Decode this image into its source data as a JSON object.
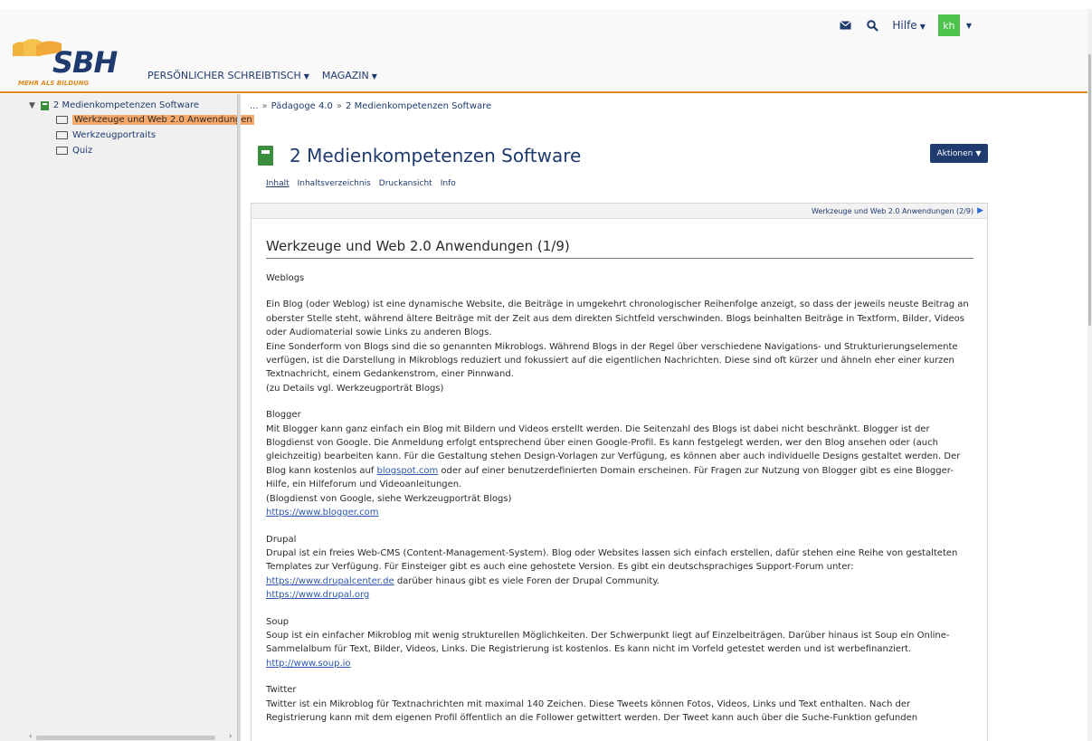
{
  "header": {
    "logo_text": "SBH",
    "logo_tagline": "MEHR ALS BILDUNG",
    "help_label": "Hilfe",
    "user_initials": "kh",
    "nav": [
      {
        "label": "Persönlicher Schreibtisch"
      },
      {
        "label": "Magazin"
      }
    ],
    "icons": {
      "mail": "mail-icon",
      "search": "search-icon"
    },
    "accent_color": "#e08a1e",
    "avatar_color": "#4dc24d"
  },
  "sidebar": {
    "root": "2 Medienkompetenzen Software",
    "items": [
      {
        "label": "Werkzeuge und Web 2.0 Anwendungen",
        "active": true
      },
      {
        "label": "Werkzeugportraits",
        "active": false
      },
      {
        "label": "Quiz",
        "active": false
      }
    ]
  },
  "breadcrumb": {
    "ellipsis": "...",
    "separator": "»",
    "items": [
      "Pädagoge 4.0",
      "2 Medienkompetenzen Software"
    ]
  },
  "page": {
    "title": "2 Medienkompetenzen Software",
    "actions_label": "Aktionen",
    "tabs": [
      {
        "label": "Inhalt",
        "active": true
      },
      {
        "label": "Inhaltsverzeichnis",
        "active": false
      },
      {
        "label": "Druckansicht",
        "active": false
      },
      {
        "label": "Info",
        "active": false
      }
    ],
    "next_link": "Werkzeuge und Web 2.0 Anwendungen (2/9)"
  },
  "article": {
    "title": "Werkzeuge und Web 2.0 Anwendungen (1/9)",
    "weblogs_heading": "Weblogs",
    "weblogs_p1": "Ein Blog (oder Weblog) ist eine dynamische Website, die Beiträge in umgekehrt chronologischer Reihenfolge anzeigt, so dass der jeweils neuste Beitrag an oberster Stelle steht, während ältere Beiträge mit der Zeit aus dem direkten Sichtfeld verschwinden. Blogs beinhalten Beiträge in Textform, Bilder, Videos oder Audiomaterial sowie Links zu anderen Blogs.",
    "weblogs_p2": "Eine Sonderform von Blogs sind die so genannten Mikroblogs. Während Blogs in der Regel über verschiedene Navigations- und Strukturierungselemente verfügen, ist die Darstellung in Mikroblogs reduziert und fokussiert auf die eigentlichen Nachrichten. Diese sind oft kürzer und ähneln eher einer kurzen Textnachricht, einem Gedankenstrom, einer Pinnwand.",
    "weblogs_p3": "(zu Details vgl. Werkzeugporträt Blogs)",
    "blogger_heading": "Blogger",
    "blogger_text1": "Mit Blogger kann ganz einfach ein Blog mit Bildern und Videos erstellt werden. Die Seitenzahl des Blogs ist dabei nicht beschränkt. Blogger ist der Blogdienst von Google. Die Anmeldung erfolgt entsprechend über einen Google-Profil. Es kann festgelegt werden, wer den Blog ansehen oder (auch gleichzeitig) bearbeiten kann. Für die Gestaltung stehen Design-Vorlagen zur Verfügung, es können aber auch individuelle Designs gestaltet werden. Der Blog kann kostenlos auf ",
    "blogger_link1": "blogspot.com",
    "blogger_text2": " oder auf einer benutzerdefinierten Domain erscheinen. Für Fragen zur Nutzung von Blogger gibt es eine Blogger-Hilfe, ein Hilfeforum und Videoanleitungen.",
    "blogger_text3": "(Blogdienst von Google, siehe Werkzeugporträt Blogs)",
    "blogger_url": "https://www.blogger.com",
    "drupal_heading": "Drupal",
    "drupal_text1": "Drupal ist ein freies Web-CMS (Content-Management-System). Blog oder Websites lassen sich einfach erstellen, dafür stehen eine Reihe von gestalteten Templates zur Verfügung. Für Einsteiger gibt es auch eine gehostete Version. Es gibt ein deutschsprachiges Support-Forum unter:",
    "drupal_link1": "https://www.drupalcenter.de",
    "drupal_text2": " darüber hinaus gibt es viele Foren der Drupal Community.",
    "drupal_url": "https://www.drupal.org",
    "soup_heading": "Soup",
    "soup_text": "Soup ist ein einfacher Mikroblog mit wenig strukturellen Möglichkeiten. Der Schwerpunkt liegt auf Einzelbeiträgen. Darüber hinaus ist Soup ein Online-Sammelalbum für Text, Bilder, Videos, Links. Die Registrierung ist kostenlos. Es kann nicht im Vorfeld getestet werden und ist werbefinanziert.",
    "soup_url": "http://www.soup.io",
    "twitter_heading": "Twitter",
    "twitter_text": "Twitter ist ein Mikroblog für Textnachrichten mit maximal 140 Zeichen. Diese Tweets können Fotos, Videos, Links und Text enthalten. Nach der Registrierung kann mit dem eigenen Profil öffentlich an die Follower getwittert werden. Der Tweet kann auch über die Suche-Funktion gefunden"
  }
}
